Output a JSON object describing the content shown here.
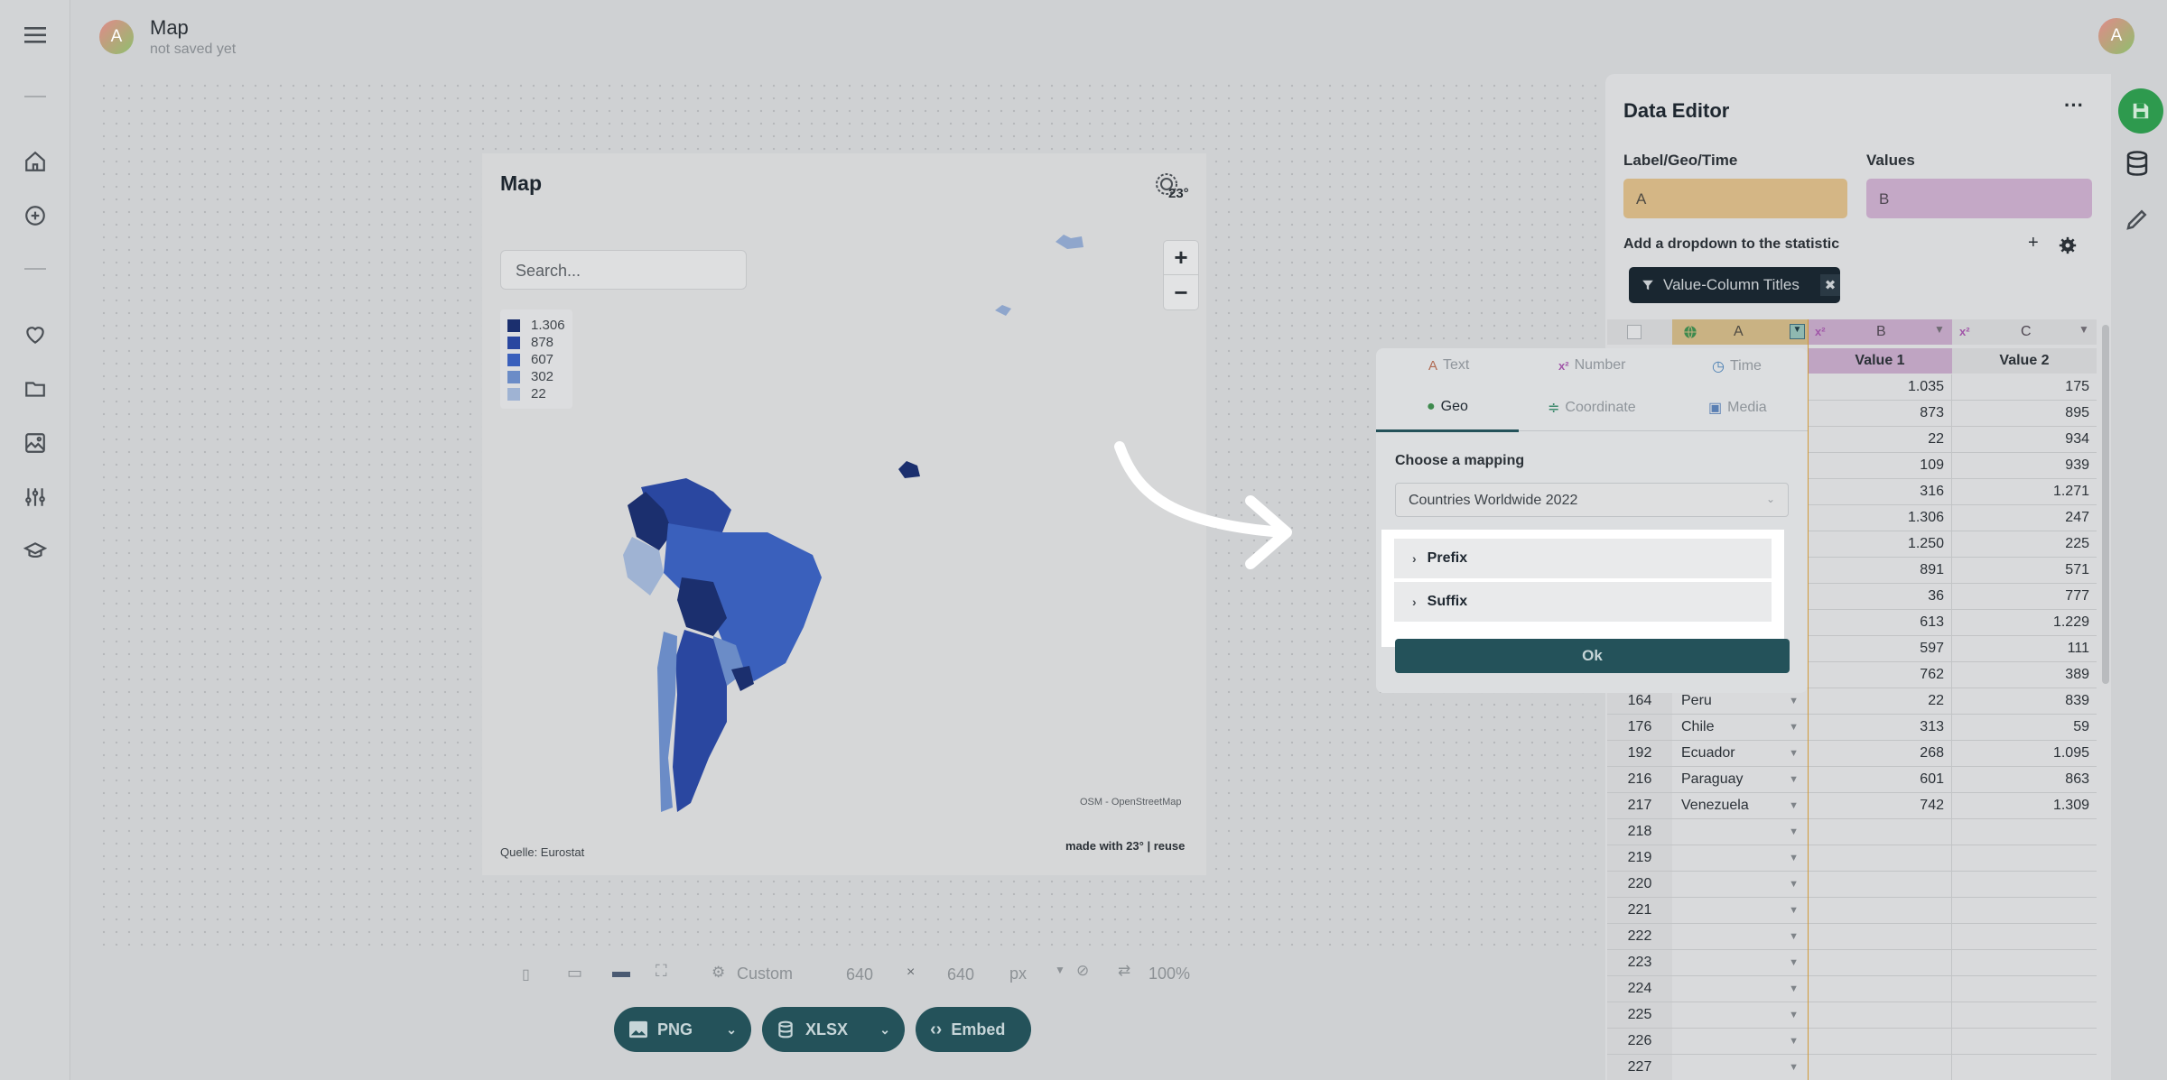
{
  "header": {
    "title": "Map",
    "subtitle": "not saved yet",
    "avatar_letter": "A"
  },
  "rail_icons": [
    "hamburger-icon",
    "home-icon",
    "add-circle-icon",
    "heart-icon",
    "folder-icon",
    "image-icon",
    "sliders-icon",
    "graduation-cap-icon"
  ],
  "map": {
    "title": "Map",
    "logo_text": "23°",
    "search_placeholder": "Search...",
    "legend": [
      {
        "label": "1.306",
        "color": "#1b2f6e"
      },
      {
        "label": "878",
        "color": "#2a47a0"
      },
      {
        "label": "607",
        "color": "#3a60bc"
      },
      {
        "label": "302",
        "color": "#6b8cc7"
      },
      {
        "label": "22",
        "color": "#9fb3d3"
      }
    ],
    "zoom_in": "+",
    "zoom_out": "−",
    "attribution": "OSM - OpenStreetMap",
    "source": "Quelle: Eurostat",
    "made_with": "made with 23° | reuse"
  },
  "dialog": {
    "tabs": [
      {
        "label": "Text",
        "icon": "text-type-icon",
        "color": "#b06a52"
      },
      {
        "label": "Number",
        "icon": "number-type-icon",
        "color": "#a156a8"
      },
      {
        "label": "Time",
        "icon": "clock-icon",
        "color": "#4a7fb3"
      },
      {
        "label": "Geo",
        "icon": "globe-icon",
        "color": "#3e8a4e"
      },
      {
        "label": "Coordinate",
        "icon": "coordinate-icon",
        "color": "#3e8a6e"
      },
      {
        "label": "Media",
        "icon": "media-icon",
        "color": "#5a7fb3"
      }
    ],
    "mapping_label": "Choose a mapping",
    "mapping_value": "Countries Worldwide 2022",
    "prefix_label": "Prefix",
    "suffix_label": "Suffix",
    "ok_label": "Ok"
  },
  "editor": {
    "title": "Data Editor",
    "more": "···",
    "label_geo_time": "Label/Geo/Time",
    "values_label": "Values",
    "chip_a": "A",
    "chip_b": "B",
    "dropdown_label": "Add a dropdown to the statistic",
    "plus": "+",
    "filter_chip": "Value-Column Titles",
    "filter_close": "✖",
    "col_a": "A",
    "col_b": "B",
    "col_c": "C",
    "type_badge": "x²",
    "col_b_title": "Value 1",
    "col_c_title": "Value 2",
    "rows": [
      {
        "id": "",
        "name": "",
        "b": "1.035",
        "c": "175"
      },
      {
        "id": "",
        "name": "",
        "b": "873",
        "c": "895"
      },
      {
        "id": "",
        "name": "",
        "b": "22",
        "c": "934"
      },
      {
        "id": "",
        "name": "",
        "b": "109",
        "c": "939"
      },
      {
        "id": "",
        "name": "",
        "b": "316",
        "c": "1.271"
      },
      {
        "id": "",
        "name": "",
        "b": "1.306",
        "c": "247"
      },
      {
        "id": "",
        "name": "",
        "b": "1.250",
        "c": "225"
      },
      {
        "id": "",
        "name": "",
        "b": "891",
        "c": "571"
      },
      {
        "id": "",
        "name": "",
        "b": "36",
        "c": "777"
      },
      {
        "id": "",
        "name": "",
        "b": "613",
        "c": "1.229"
      },
      {
        "id": "",
        "name": "",
        "b": "597",
        "c": "111"
      },
      {
        "id": "",
        "name": "",
        "b": "762",
        "c": "389"
      },
      {
        "id": "164",
        "name": "Peru",
        "b": "22",
        "c": "839"
      },
      {
        "id": "176",
        "name": "Chile",
        "b": "313",
        "c": "59"
      },
      {
        "id": "192",
        "name": "Ecuador",
        "b": "268",
        "c": "1.095"
      },
      {
        "id": "216",
        "name": "Paraguay",
        "b": "601",
        "c": "863"
      },
      {
        "id": "217",
        "name": "Venezuela",
        "b": "742",
        "c": "1.309"
      },
      {
        "id": "218",
        "name": "",
        "b": "",
        "c": ""
      },
      {
        "id": "219",
        "name": "",
        "b": "",
        "c": ""
      },
      {
        "id": "220",
        "name": "",
        "b": "",
        "c": ""
      },
      {
        "id": "221",
        "name": "",
        "b": "",
        "c": ""
      },
      {
        "id": "222",
        "name": "",
        "b": "",
        "c": ""
      },
      {
        "id": "223",
        "name": "",
        "b": "",
        "c": ""
      },
      {
        "id": "224",
        "name": "",
        "b": "",
        "c": ""
      },
      {
        "id": "225",
        "name": "",
        "b": "",
        "c": ""
      },
      {
        "id": "226",
        "name": "",
        "b": "",
        "c": ""
      },
      {
        "id": "227",
        "name": "",
        "b": "",
        "c": ""
      }
    ]
  },
  "toolbar": {
    "custom_label": "Custom",
    "width": "640",
    "times": "×",
    "height": "640",
    "unit": "px",
    "zoom": "100%",
    "png": "PNG",
    "xlsx": "XLSX",
    "embed": "Embed"
  },
  "colors": {
    "accent": "#24525a",
    "save": "#2e9a4e"
  }
}
